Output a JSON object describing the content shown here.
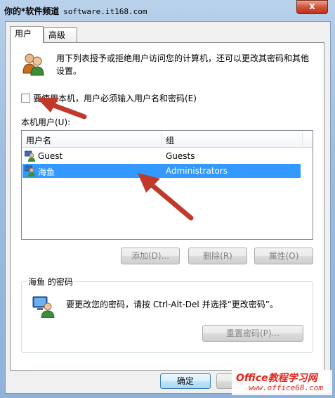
{
  "titlebar": {
    "watermark": "你的*软件频道",
    "watermark_site": "software.it168.com",
    "close_label": "x"
  },
  "tabs": [
    {
      "label": "用户",
      "active": true
    },
    {
      "label": "高级",
      "active": false
    }
  ],
  "intro": {
    "icon": "users-icon",
    "text": "用下列表授予或拒绝用户访问您的计算机，还可以更改其密码和其他设置。"
  },
  "require_password": {
    "label": "要使用本机，用户必须输入用户名和密码(E)",
    "checked": false
  },
  "users_list": {
    "label": "本机用户(U):",
    "columns": [
      "用户名",
      "组"
    ],
    "rows": [
      {
        "name": "Guest",
        "group": "Guests",
        "selected": false
      },
      {
        "name": "海鱼",
        "group": "Administrators",
        "selected": true
      }
    ]
  },
  "actions": {
    "add": "添加(D)...",
    "remove": "删除(R)",
    "properties": "属性(O)"
  },
  "password_group": {
    "label": "海鱼 的密码",
    "text": "要更改您的密码，请按 Ctrl-Alt-Del 并选择“更改密码”。",
    "reset_button": "重置密码(P)..."
  },
  "footer": {
    "ok": "确定",
    "cancel": "取"
  },
  "watermark_bottom": {
    "line1": "Office教程学习网",
    "line2": "www.office68.com"
  },
  "colors": {
    "selection": "#3399ff",
    "arrow": "#c0392b"
  }
}
